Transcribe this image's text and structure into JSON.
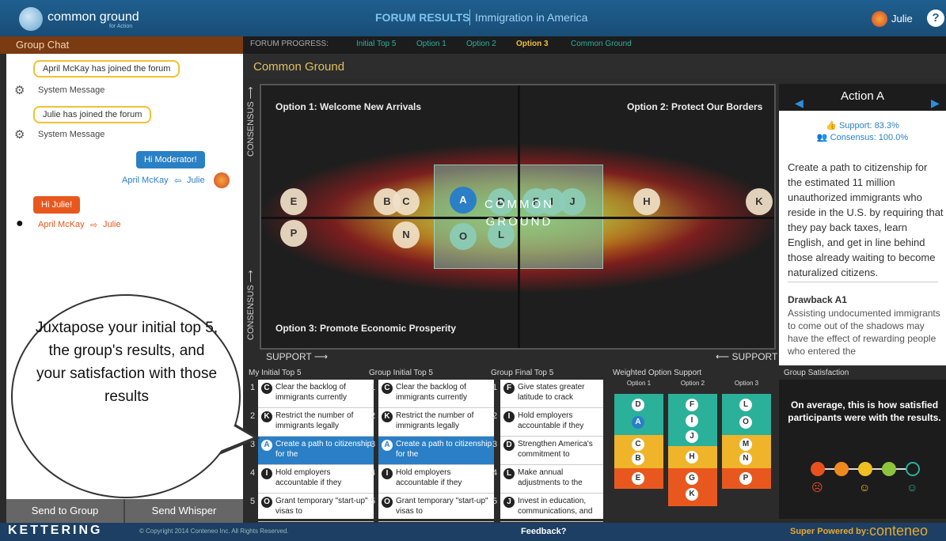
{
  "app": {
    "title": "common ground",
    "subtitle": "for Action",
    "header_title": "FORUM RESULTS",
    "header_subtitle": "Immigration in America",
    "user": "Julie",
    "help": "?"
  },
  "chat": {
    "title": "Group Chat",
    "messages": [
      {
        "text": "April McKay has joined the forum",
        "sender": "System Message"
      },
      {
        "text": "Julie has joined the forum",
        "sender": "System Message"
      },
      {
        "text": "Hi Moderator!",
        "from": "April McKay",
        "to": "Julie"
      },
      {
        "text": "Hi Julie!",
        "from": "April McKay",
        "to": "Julie"
      }
    ],
    "send_group": "Send to Group",
    "send_whisper": "Send Whisper"
  },
  "progress": {
    "label": "FORUM PROGRESS:",
    "steps": [
      "Initial Top 5",
      "Option 1",
      "Option 2",
      "Option 3",
      "Common Ground"
    ],
    "active": "Option 3"
  },
  "section_title": "Common Ground",
  "chart": {
    "q1": "Option 1: Welcome New Arrivals",
    "q2": "Option 2: Protect Our Borders",
    "q3": "Option 3: Promote Economic Prosperity",
    "center": "COMMON GROUND",
    "consensus": "CONSENSUS",
    "support_left": "SUPPORT ⟶",
    "support_right": "⟵ SUPPORT",
    "dots": [
      "E",
      "B",
      "C",
      "A",
      "D",
      "F",
      "I",
      "J",
      "H",
      "K",
      "P",
      "N",
      "O",
      "L"
    ]
  },
  "action": {
    "title": "Action A",
    "support": "Support: 83.3%",
    "consensus": "Consensus: 100.0%",
    "text": "Create a path to citizenship for the estimated 11 million unauthorized immigrants who reside in the U.S. by requiring that they pay back taxes, learn English, and get in line behind those already waiting to become naturalized citizens.",
    "drawback_title": "Drawback A1",
    "drawback_text": "Assisting undocumented immigrants to come out of the shadows may have the effect of rewarding people who entered the"
  },
  "lists": {
    "my": {
      "title": "My Initial Top 5",
      "rows": [
        [
          "1",
          "C",
          "Clear the backlog of immigrants currently"
        ],
        [
          "2",
          "K",
          "Restrict the number of immigrants legally"
        ],
        [
          "3",
          "A",
          "Create a path to citizenship for the"
        ],
        [
          "4",
          "I",
          "Hold employers accountable if they"
        ],
        [
          "5",
          "O",
          "Grant temporary \"start-up\" visas to"
        ]
      ]
    },
    "group_init": {
      "title": "Group Initial Top 5",
      "rows": [
        [
          "1",
          "C",
          "Clear the backlog of immigrants currently"
        ],
        [
          "2",
          "K",
          "Restrict the number of immigrants legally"
        ],
        [
          "3",
          "A",
          "Create a path to citizenship for the"
        ],
        [
          "4",
          "I",
          "Hold employers accountable if they"
        ],
        [
          "5",
          "O",
          "Grant temporary \"start-up\" visas to"
        ]
      ]
    },
    "group_final": {
      "title": "Group Final Top 5",
      "rows": [
        [
          "1",
          "F",
          "Give states greater latitude to crack"
        ],
        [
          "2",
          "I",
          "Hold employers accountable if they"
        ],
        [
          "3",
          "D",
          "Strengthen America's commitment to"
        ],
        [
          "4",
          "L",
          "Make annual adjustments to the"
        ],
        [
          "5",
          "J",
          "Invest in education, communications, and"
        ]
      ]
    }
  },
  "weighted": {
    "title": "Weighted Option Support",
    "cols": [
      {
        "name": "Option 1",
        "items": [
          "D",
          "A",
          "C",
          "B",
          "E"
        ]
      },
      {
        "name": "Option 2",
        "items": [
          "F",
          "I",
          "J",
          "H",
          "G",
          "K"
        ]
      },
      {
        "name": "Option 3",
        "items": [
          "L",
          "O",
          "M",
          "N",
          "P"
        ]
      }
    ]
  },
  "satisfaction": {
    "title": "Group Satisfaction",
    "text": "On average, this is how satisfied participants were with the results."
  },
  "callout": "Juxtapose your initial top 5, the group's results, and your satisfaction with those results",
  "footer": {
    "logo": "KETTERING",
    "copyright": "© Copyright 2014 Conteneo Inc. All Rights Reserved.",
    "feedback": "Feedback?",
    "powered": "Super Powered by:",
    "brand": "conteneo"
  }
}
